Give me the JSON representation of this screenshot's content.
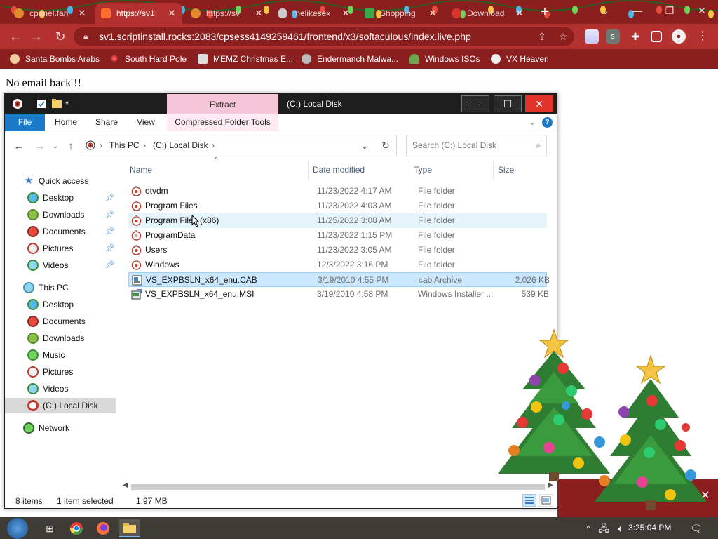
{
  "browser": {
    "tabs": [
      {
        "title": "cpanel.fan",
        "favicon_color": "#e38b2c",
        "active": false
      },
      {
        "title": "https://sv1",
        "favicon_color": "#ff6c2c",
        "active": true
      },
      {
        "title": "https://sv",
        "favicon_color": "#e38b2c",
        "active": false
      },
      {
        "title": "melikesex",
        "favicon_color": "#cccccc",
        "active": false
      },
      {
        "title": "Shopping",
        "favicon_color": "#3aa84a",
        "active": false
      },
      {
        "title": "Download",
        "favicon_color": "#d9342b",
        "active": false
      }
    ],
    "new_tab_label": "+",
    "url": "sv1.scriptinstall.rocks:2083/cpsess4149259461/frontend/x3/softaculous/index.live.php",
    "ext_label": "s",
    "bookmarks": [
      {
        "label": "Santa Bombs Arabs",
        "icon": "santa-icon"
      },
      {
        "label": "South Hard Pole",
        "icon": "snowflake-icon"
      },
      {
        "label": "MEMZ Christmas E...",
        "icon": "gift-icon"
      },
      {
        "label": "Endermanch Malwa...",
        "icon": "raccoon-icon"
      },
      {
        "label": "Windows ISOs",
        "icon": "elf-icon"
      },
      {
        "label": "VX Heaven",
        "icon": "skull-icon"
      }
    ]
  },
  "page": {
    "heading": "No email back !!"
  },
  "explorer": {
    "context_tab": "Extract",
    "title": "(C:) Local Disk",
    "ribbon_tabs": [
      "File",
      "Home",
      "Share",
      "View",
      "Compressed Folder Tools"
    ],
    "breadcrumb": [
      "This PC",
      "(C:) Local Disk"
    ],
    "search_placeholder": "Search (C:) Local Disk",
    "nav": {
      "quick_access": "Quick access",
      "quick_items": [
        "Desktop",
        "Downloads",
        "Documents",
        "Pictures",
        "Videos"
      ],
      "this_pc": "This PC",
      "pc_items": [
        "Desktop",
        "Documents",
        "Downloads",
        "Music",
        "Pictures",
        "Videos",
        "(C:) Local Disk"
      ],
      "network": "Network"
    },
    "columns": {
      "name": "Name",
      "date": "Date modified",
      "type": "Type",
      "size": "Size"
    },
    "files": [
      {
        "name": "otvdm",
        "date": "11/23/2022 4:17 AM",
        "type": "File folder",
        "size": "",
        "kind": "folder"
      },
      {
        "name": "Program Files",
        "date": "11/23/2022 4:03 AM",
        "type": "File folder",
        "size": "",
        "kind": "folder"
      },
      {
        "name": "Program Files (x86)",
        "date": "11/25/2022 3:08 AM",
        "type": "File folder",
        "size": "",
        "kind": "folder"
      },
      {
        "name": "ProgramData",
        "date": "11/23/2022 1:15 PM",
        "type": "File folder",
        "size": "",
        "kind": "folder"
      },
      {
        "name": "Users",
        "date": "11/23/2022 3:05 AM",
        "type": "File folder",
        "size": "",
        "kind": "folder"
      },
      {
        "name": "Windows",
        "date": "12/3/2022 3:16 PM",
        "type": "File folder",
        "size": "",
        "kind": "folder"
      },
      {
        "name": "VS_EXPBSLN_x64_enu.CAB",
        "date": "3/19/2010 4:55 PM",
        "type": "cab Archive",
        "size": "2,026 KB",
        "kind": "cab"
      },
      {
        "name": "VS_EXPBSLN_x64_enu.MSI",
        "date": "3/19/2010 4:58 PM",
        "type": "Windows Installer ...",
        "size": "539 KB",
        "kind": "msi"
      }
    ],
    "status": {
      "items": "8 items",
      "selection": "1 item selected",
      "size": "1.97 MB"
    }
  },
  "taskbar": {
    "clock": "3:25:04 PM"
  },
  "colors": {
    "chrome_dark": "#8b1e1e",
    "chrome_red": "#b3312e",
    "explorer_accent": "#1979ca",
    "selection": "#cce8ff"
  }
}
